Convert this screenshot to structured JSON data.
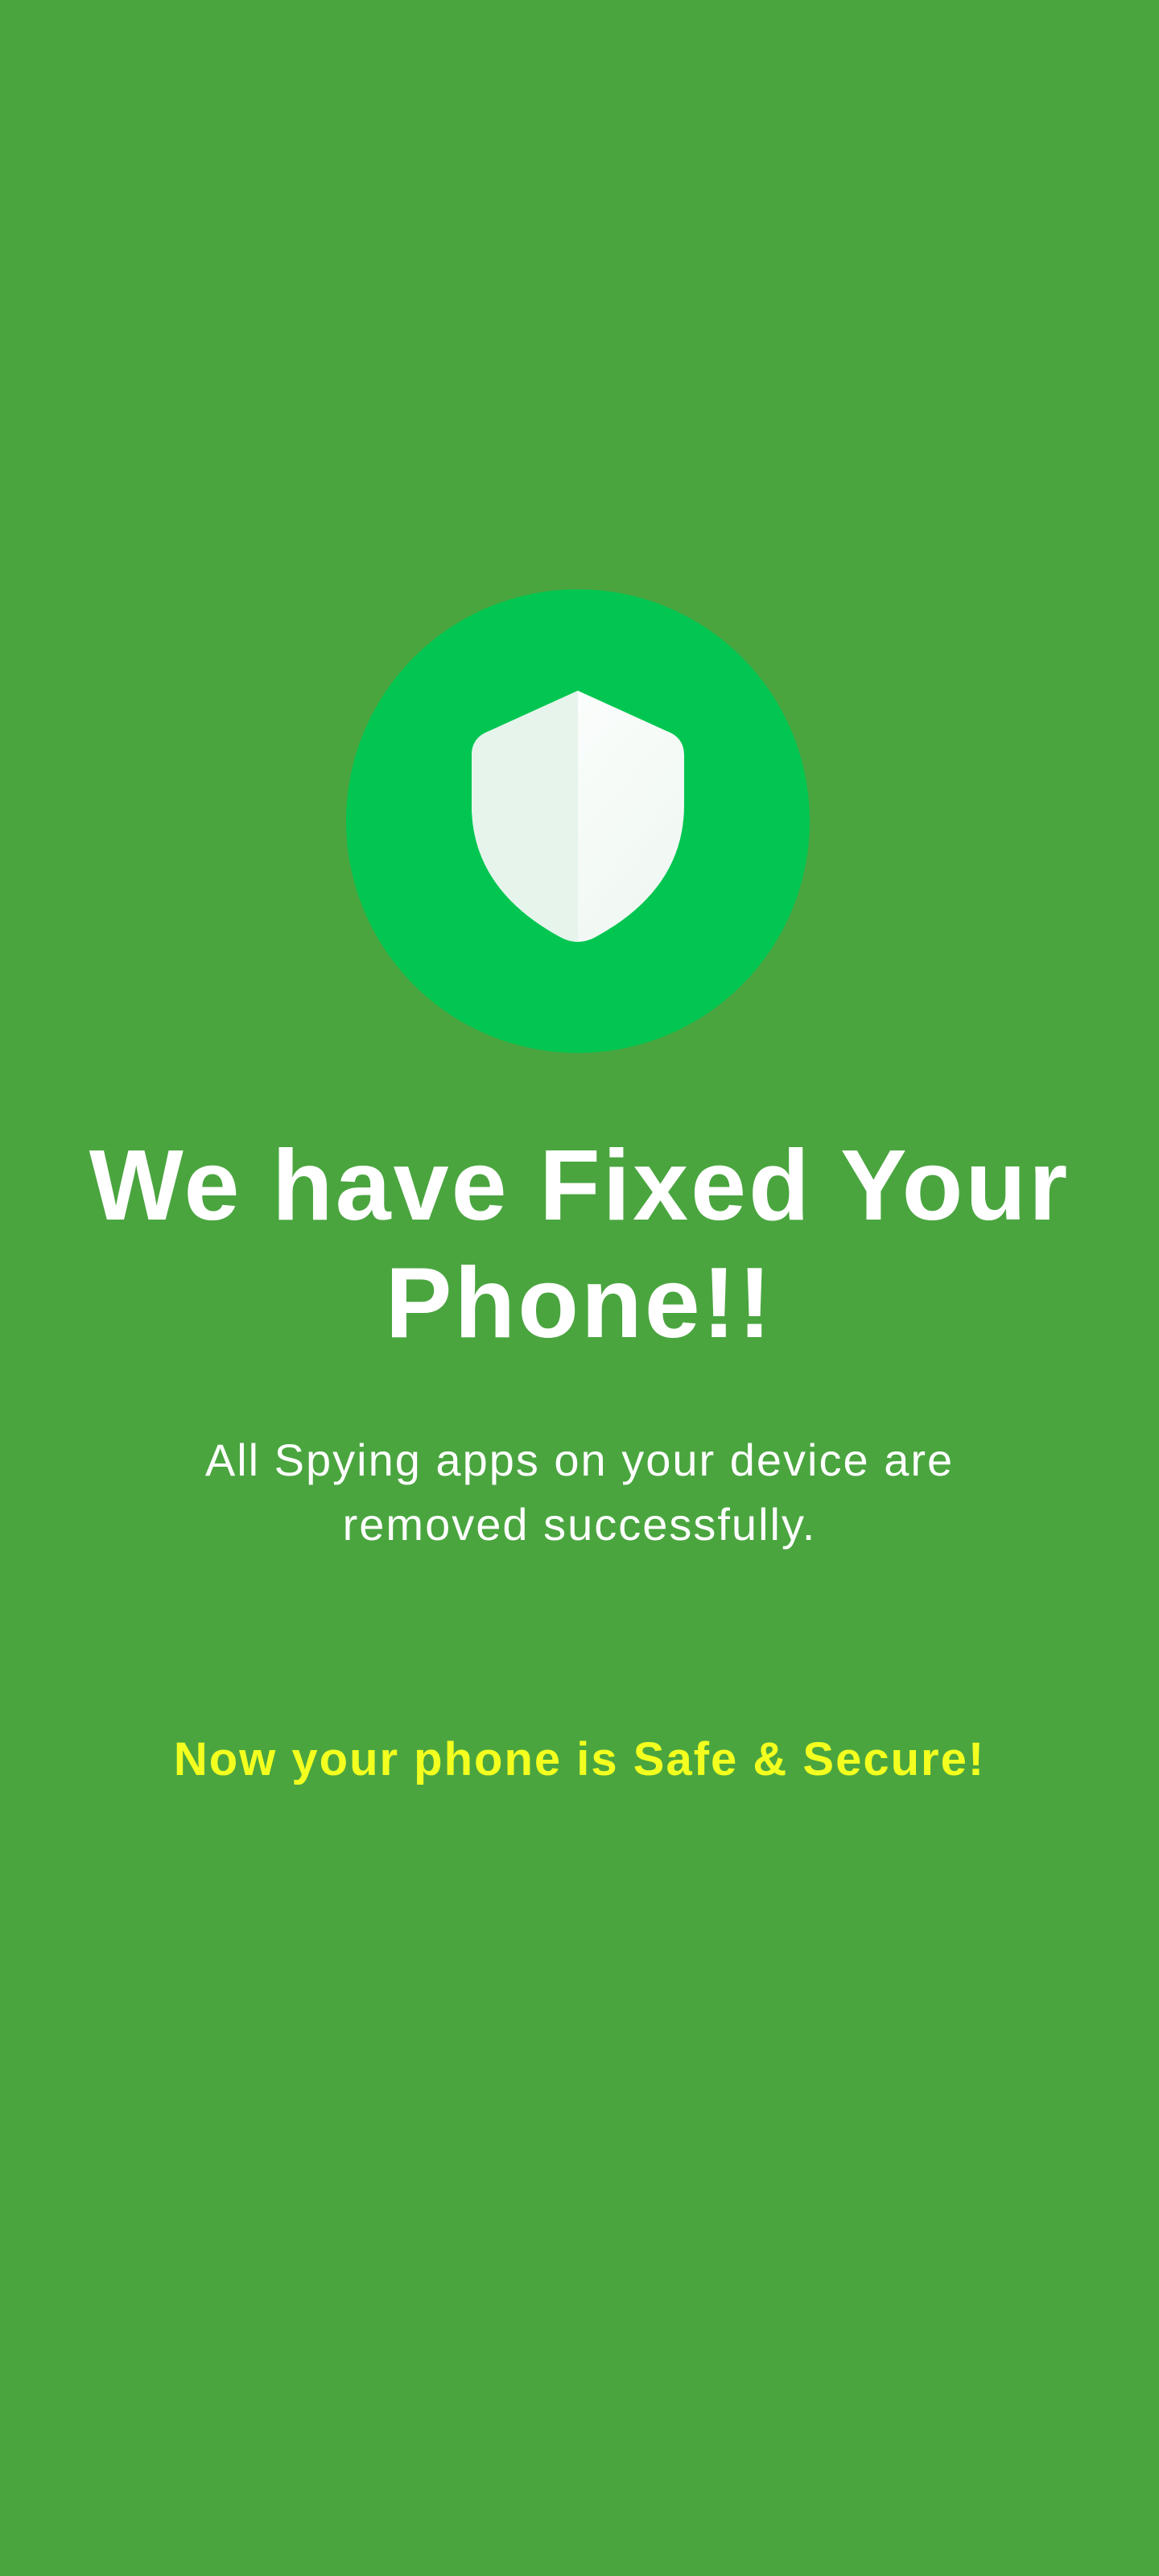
{
  "colors": {
    "background": "#4aa53f",
    "badge": "#02c651",
    "shield_left": "#e6f4ec",
    "shield_right": "#f7fbf8",
    "headline": "#ffffff",
    "subtext": "#ffffff",
    "safe_message": "#f3ff1f"
  },
  "icon": {
    "name": "shield-icon"
  },
  "headline": "We have Fixed Your Phone!!",
  "subtext": "All Spying apps on your device are removed successfully.",
  "safe_message": "Now your phone is Safe & Secure!"
}
